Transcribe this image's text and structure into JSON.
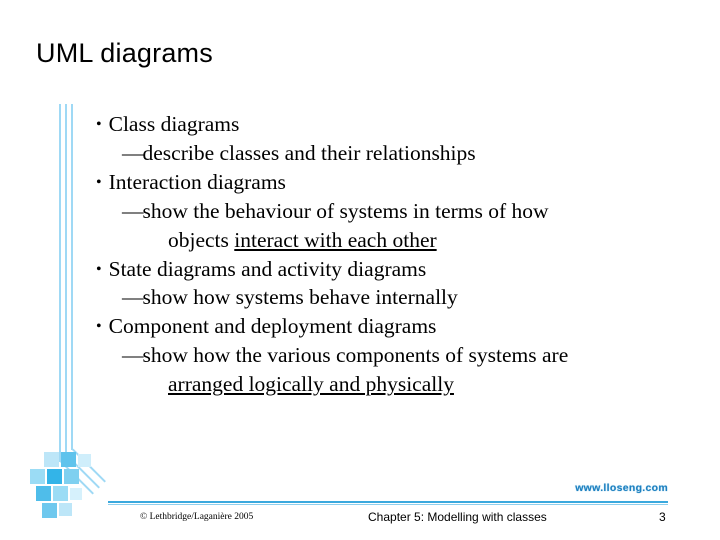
{
  "slide": {
    "title": "UML diagrams",
    "bullets": [
      {
        "level": 1,
        "marker": "•",
        "text": "Class diagrams"
      },
      {
        "level": 2,
        "marker": "—",
        "text": "describe classes and their relationships"
      },
      {
        "level": 1,
        "marker": "•",
        "text": "Interaction diagrams"
      },
      {
        "level": 2,
        "marker": "—",
        "text": "show the behaviour of systems in terms of how"
      },
      {
        "level": 3,
        "marker": "",
        "text": "objects ",
        "underlined": "interact with each other"
      },
      {
        "level": 1,
        "marker": "•",
        "text": "State diagrams and activity diagrams"
      },
      {
        "level": 2,
        "marker": "—",
        "text": "show how systems behave internally"
      },
      {
        "level": 1,
        "marker": "•",
        "text": "Component and deployment diagrams"
      },
      {
        "level": 2,
        "marker": "—",
        "text": "show how the various components of systems are"
      },
      {
        "level": 3,
        "marker": "",
        "text": "",
        "underlined": "arranged logically and physically"
      }
    ],
    "footer": {
      "website": "www.lloseng.com",
      "copyright": "© Lethbridge/Laganière 2005",
      "chapter": "Chapter 5: Modelling with classes",
      "page_number": "3"
    },
    "colors": {
      "accent_line": "#3aa8dd",
      "decor_light": "#9fd9f5",
      "website_text": "#1f7fbf"
    }
  }
}
